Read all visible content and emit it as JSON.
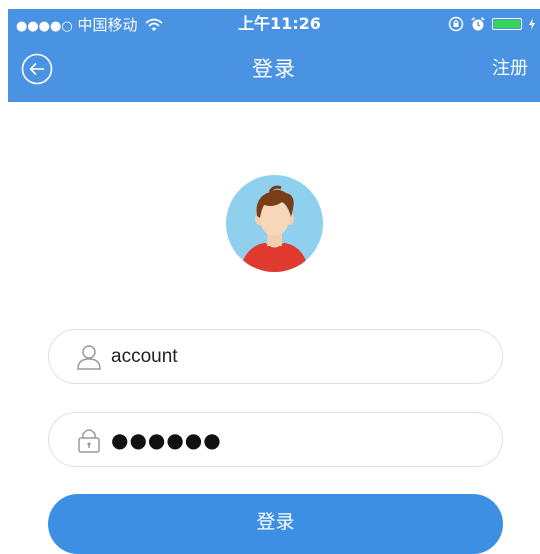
{
  "status_bar": {
    "signal_dots": "●●●●○",
    "carrier": "中国移动",
    "wifi_icon": "wifi-icon",
    "time": "上午11:26",
    "lock_icon": "orientation-lock-icon",
    "alarm_icon": "alarm-icon",
    "battery_color": "#34d662"
  },
  "nav": {
    "back_icon": "back-circle-icon",
    "title": "登录",
    "register_label": "注册",
    "background": "#4a93e3"
  },
  "avatar": {
    "icon": "user-avatar",
    "background": "#8ed0ee"
  },
  "form": {
    "account": {
      "icon": "user-icon",
      "value": "account"
    },
    "password": {
      "icon": "lock-icon",
      "masked_value": "●●●●●●"
    },
    "login_label": "登录",
    "login_color": "#3d8fe3"
  }
}
